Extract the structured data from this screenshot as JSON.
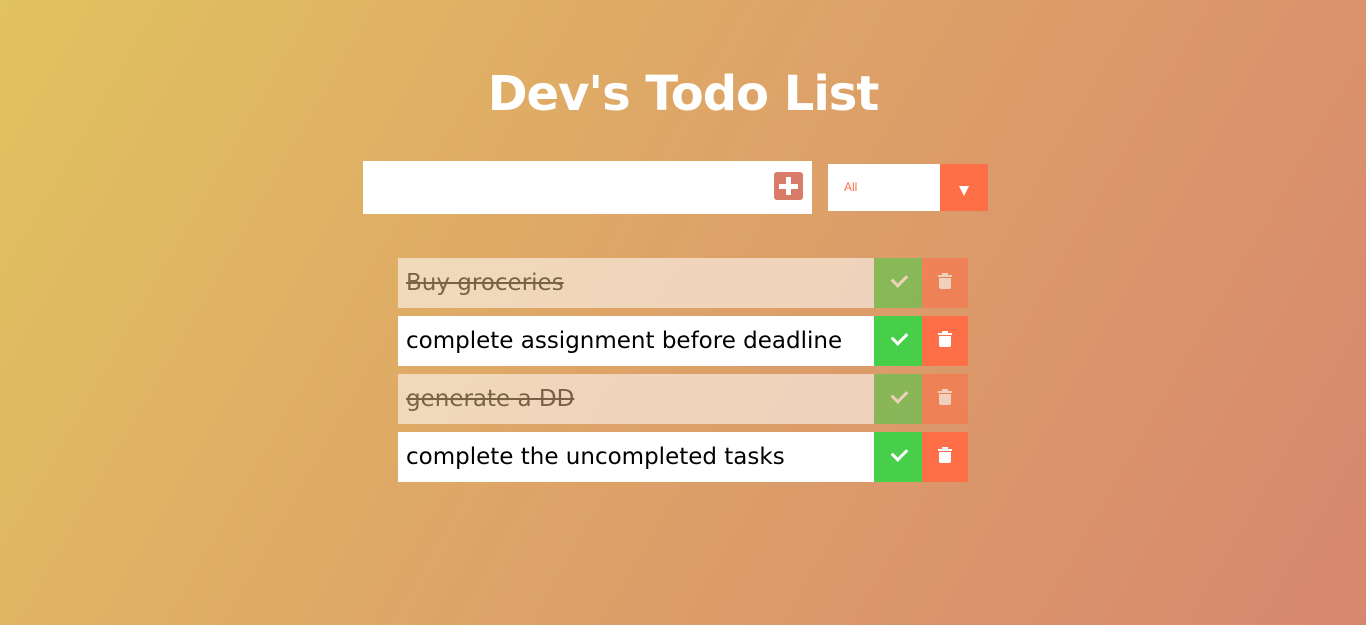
{
  "header": {
    "title": "Dev's Todo List"
  },
  "form": {
    "input_value": "",
    "input_placeholder": "",
    "add_icon": "plus-square-icon"
  },
  "filter": {
    "selected": "All",
    "toggle_icon": "caret-down-icon"
  },
  "todos": [
    {
      "text": "Buy groceries",
      "completed": true
    },
    {
      "text": "complete assignment before deadline",
      "completed": false
    },
    {
      "text": "generate a DD",
      "completed": true
    },
    {
      "text": "complete the uncompleted tasks",
      "completed": false
    }
  ],
  "colors": {
    "accent": "#ff6f47",
    "complete_button": "#47cf4a",
    "add_button": "#d87b68",
    "background_start": "#e1c35f",
    "background_end": "#d7876f"
  }
}
